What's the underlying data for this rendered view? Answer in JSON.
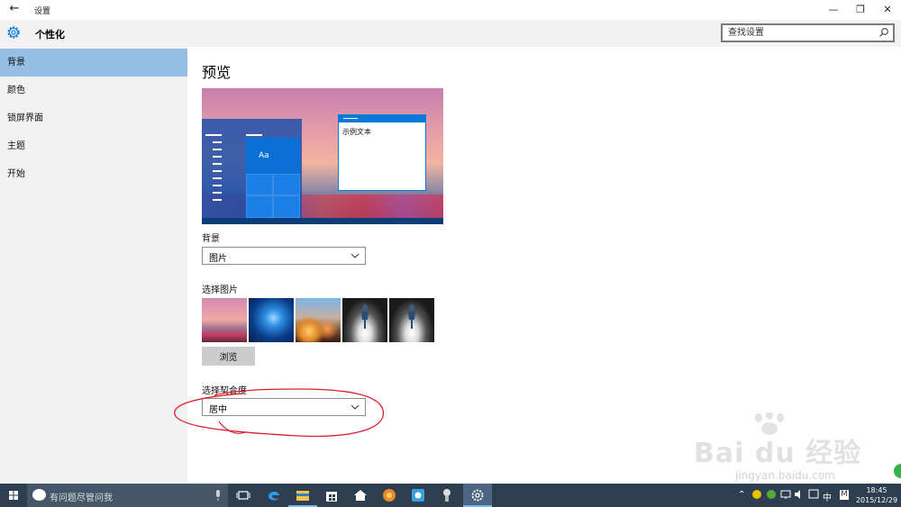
{
  "window": {
    "title": "设置",
    "back_icon": "back-arrow-icon",
    "minimize_glyph": "—",
    "maximize_glyph": "❐",
    "close_glyph": "✕"
  },
  "header": {
    "title": "个性化",
    "search_placeholder": "查找设置"
  },
  "sidebar": {
    "items": [
      {
        "label": "背景",
        "active": true
      },
      {
        "label": "颜色",
        "active": false
      },
      {
        "label": "锁屏界面",
        "active": false
      },
      {
        "label": "主题",
        "active": false
      },
      {
        "label": "开始",
        "active": false
      }
    ]
  },
  "main": {
    "preview_heading": "预览",
    "preview_sample_text": "示例文本",
    "preview_tile_text": "Aa",
    "background_label": "背景",
    "background_value": "图片",
    "choose_picture_label": "选择图片",
    "browse_label": "浏览",
    "fit_label": "选择契合度",
    "fit_value": "居中"
  },
  "taskbar": {
    "search_text": "有问题尽管问我",
    "tray_ime": "中",
    "tray_m": "M",
    "time": "18:45",
    "date": "2015/12/29"
  },
  "watermark": {
    "line1": "Bai du 经验",
    "line2": "jingyan.baidu.com"
  },
  "colors": {
    "accent": "#0a78d7",
    "sidebar_active": "#95bfe6",
    "taskbar": "#2d3e50",
    "annotation": "#d9202a"
  }
}
